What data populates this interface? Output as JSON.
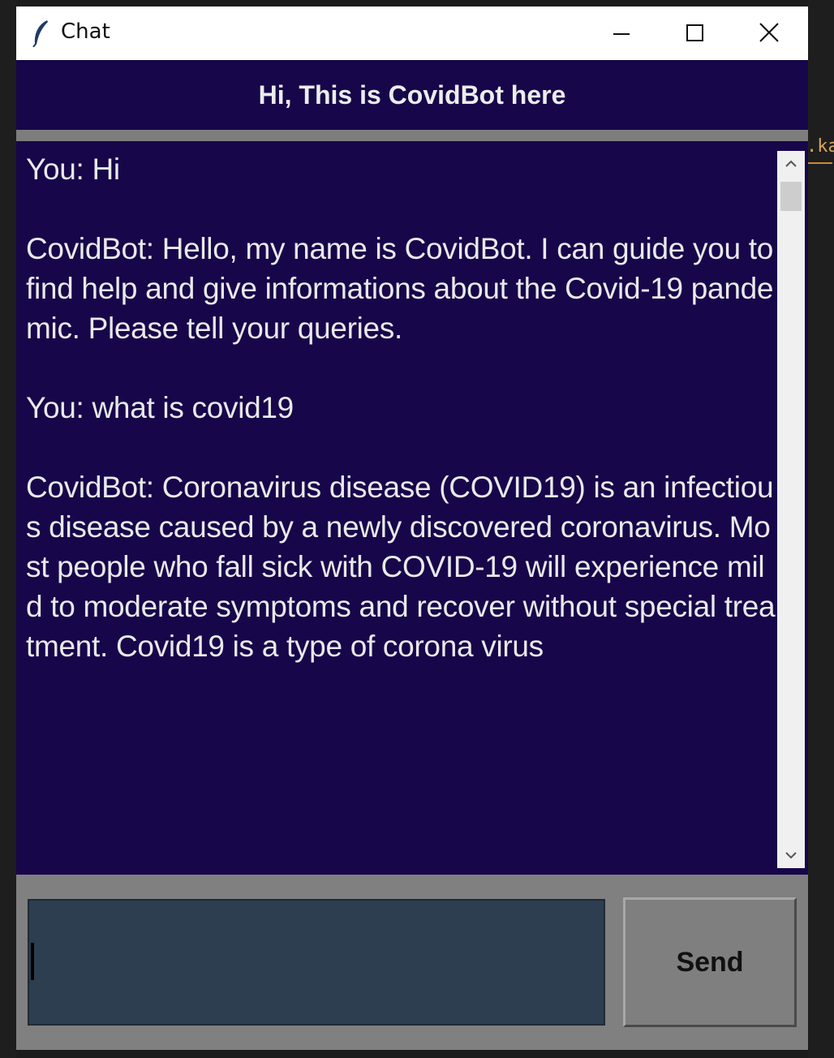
{
  "window": {
    "title": "Chat",
    "icon": "feather-icon",
    "controls": [
      "minimize-icon",
      "maximize-icon",
      "close-icon"
    ]
  },
  "header": {
    "title": "Hi, This is CovidBot here"
  },
  "messages": [
    "You: Hi",
    "CovidBot: Hello, my name is CovidBot. I can guide you to find help and give informations about the Covid-19 pandemic. Please tell your queries.",
    "You: what is covid19",
    "CovidBot: Coronavirus disease (COVID19) is an infectious disease caused by a newly discovered coronavirus. Most people who fall sick with COVID-19 will experience mild to moderate symptoms and recover without special treatment. Covid19 is a type of corona virus"
  ],
  "input": {
    "value": ""
  },
  "send_button": {
    "label": "Send"
  },
  "background": {
    "fragment_right_top": ".ka"
  },
  "colors": {
    "header_bg": "#17064a",
    "chat_bg": "#17064a",
    "text": "#e9e9e9",
    "input_bg": "#2c3e50",
    "frame": "#808080"
  }
}
